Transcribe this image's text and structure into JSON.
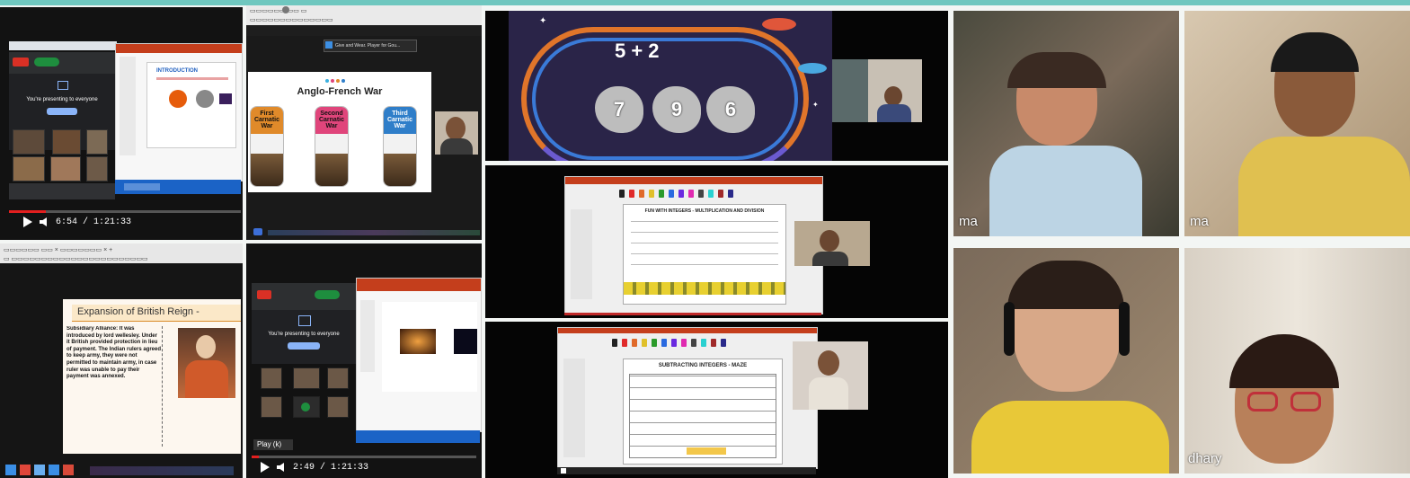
{
  "panels": {
    "presenting_top": {
      "banner": "You're presenting to everyone",
      "slide_heading": "INTRODUCTION",
      "time": "6:54 / 1:21:33"
    },
    "anglo_french": {
      "video_title": "Give and Wear. Player for Gou...",
      "slide_title": "Anglo-French War",
      "cards": [
        "First Carnatic War",
        "Second Carnatic War",
        "Third Carnatic War"
      ]
    },
    "british_reign": {
      "slide_title": "Expansion of British Reign -",
      "body": "Subsidiary Alliance: It was introduced by lord wellesley. Under it British provided protection in lieu of payment. The Indian rulers agreed to keep army, they were not permitted to maintain army, in case ruler was unable to pay their payment was annexed."
    },
    "presenting_bottom": {
      "banner": "You're presenting to everyone",
      "tooltip": "Play (k)",
      "time": "2:49 / 1:21:33"
    },
    "math_game": {
      "equation": "5 + 2",
      "options": [
        "7",
        "9",
        "6"
      ]
    },
    "worksheet_mult": {
      "title": "FUN WITH INTEGERS - MULTIPLICATION AND DIVISION"
    },
    "worksheet_sub": {
      "title": "SUBTRACTING INTEGERS - MAZE"
    },
    "cams": {
      "cam1_label": "ma",
      "cam2_label": "ma",
      "cam4_label": "dhary"
    }
  },
  "colors": {
    "accent": "#6fc7bf",
    "progress": "#e21f1f",
    "orange": "#e08a2a",
    "pink": "#e0457b",
    "blue": "#2f7ec9"
  },
  "icons": [
    "play-icon",
    "volume-icon",
    "presenting-icon",
    "chrome-tab-icon",
    "spaceship-icon"
  ]
}
